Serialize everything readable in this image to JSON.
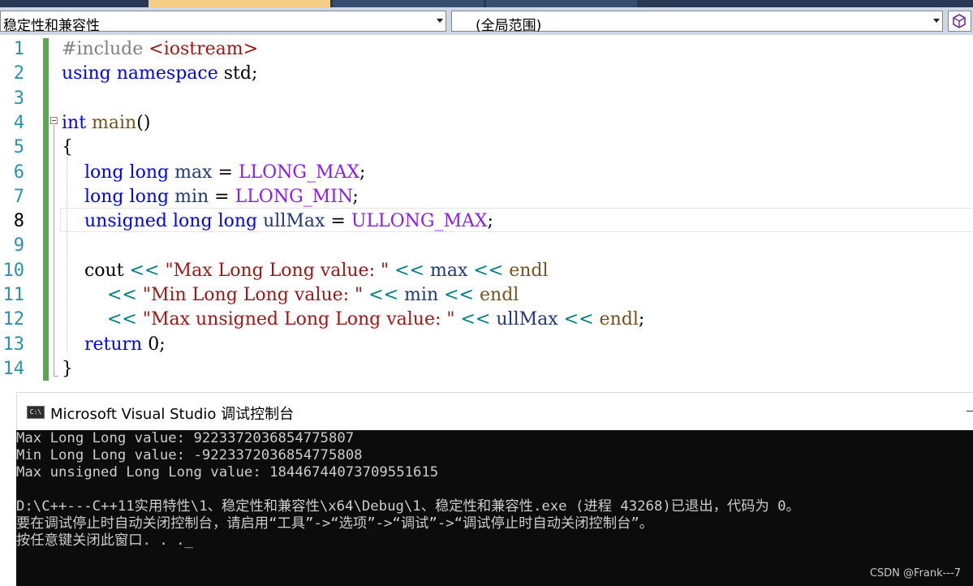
{
  "navbar": {
    "scope_left": "稳定性和兼容性",
    "scope_right": "(全局范围)"
  },
  "editor": {
    "current_line": 8,
    "lines": [
      {
        "n": "1",
        "tokens": [
          {
            "t": "#include ",
            "c": "pp"
          },
          {
            "t": "<iostream>",
            "c": "inc"
          }
        ]
      },
      {
        "n": "2",
        "tokens": [
          {
            "t": "using",
            "c": "kw"
          },
          {
            "t": " ",
            "c": "plain"
          },
          {
            "t": "namespace",
            "c": "kw"
          },
          {
            "t": " std;",
            "c": "plain"
          }
        ]
      },
      {
        "n": "3",
        "tokens": []
      },
      {
        "n": "4",
        "tokens": [
          {
            "t": "int",
            "c": "kw"
          },
          {
            "t": " ",
            "c": "plain"
          },
          {
            "t": "main",
            "c": "fn"
          },
          {
            "t": "()",
            "c": "plain"
          }
        ]
      },
      {
        "n": "5",
        "tokens": [
          {
            "t": "{",
            "c": "plain"
          }
        ]
      },
      {
        "n": "6",
        "tokens": [
          {
            "t": "    ",
            "c": "plain"
          },
          {
            "t": "long",
            "c": "kw"
          },
          {
            "t": " ",
            "c": "plain"
          },
          {
            "t": "long",
            "c": "kw"
          },
          {
            "t": " ",
            "c": "plain"
          },
          {
            "t": "max",
            "c": "id"
          },
          {
            "t": " = ",
            "c": "plain"
          },
          {
            "t": "LLONG_MAX",
            "c": "macro"
          },
          {
            "t": ";",
            "c": "plain"
          }
        ]
      },
      {
        "n": "7",
        "tokens": [
          {
            "t": "    ",
            "c": "plain"
          },
          {
            "t": "long",
            "c": "kw"
          },
          {
            "t": " ",
            "c": "plain"
          },
          {
            "t": "long",
            "c": "kw"
          },
          {
            "t": " ",
            "c": "plain"
          },
          {
            "t": "min",
            "c": "id"
          },
          {
            "t": " = ",
            "c": "plain"
          },
          {
            "t": "LLONG_MIN",
            "c": "macro"
          },
          {
            "t": ";",
            "c": "plain"
          }
        ]
      },
      {
        "n": "8",
        "tokens": [
          {
            "t": "    ",
            "c": "plain"
          },
          {
            "t": "unsigned",
            "c": "kw"
          },
          {
            "t": " ",
            "c": "plain"
          },
          {
            "t": "long",
            "c": "kw"
          },
          {
            "t": " ",
            "c": "plain"
          },
          {
            "t": "long",
            "c": "kw"
          },
          {
            "t": " ",
            "c": "plain"
          },
          {
            "t": "ullMax",
            "c": "id"
          },
          {
            "t": " = ",
            "c": "plain"
          },
          {
            "t": "ULLONG_MAX",
            "c": "macro"
          },
          {
            "t": ";",
            "c": "plain"
          }
        ]
      },
      {
        "n": "9",
        "tokens": []
      },
      {
        "n": "10",
        "tokens": [
          {
            "t": "    ",
            "c": "plain"
          },
          {
            "t": "cout",
            "c": "plain"
          },
          {
            "t": " ",
            "c": "plain"
          },
          {
            "t": "<<",
            "c": "op"
          },
          {
            "t": " ",
            "c": "plain"
          },
          {
            "t": "\"Max Long Long value: \"",
            "c": "str"
          },
          {
            "t": " ",
            "c": "plain"
          },
          {
            "t": "<<",
            "c": "op"
          },
          {
            "t": " ",
            "c": "plain"
          },
          {
            "t": "max",
            "c": "id"
          },
          {
            "t": " ",
            "c": "plain"
          },
          {
            "t": "<<",
            "c": "op"
          },
          {
            "t": " ",
            "c": "plain"
          },
          {
            "t": "endl",
            "c": "fn"
          }
        ]
      },
      {
        "n": "11",
        "tokens": [
          {
            "t": "        ",
            "c": "plain"
          },
          {
            "t": "<<",
            "c": "op"
          },
          {
            "t": " ",
            "c": "plain"
          },
          {
            "t": "\"Min Long Long value: \"",
            "c": "str"
          },
          {
            "t": " ",
            "c": "plain"
          },
          {
            "t": "<<",
            "c": "op"
          },
          {
            "t": " ",
            "c": "plain"
          },
          {
            "t": "min",
            "c": "id"
          },
          {
            "t": " ",
            "c": "plain"
          },
          {
            "t": "<<",
            "c": "op"
          },
          {
            "t": " ",
            "c": "plain"
          },
          {
            "t": "endl",
            "c": "fn"
          }
        ]
      },
      {
        "n": "12",
        "tokens": [
          {
            "t": "        ",
            "c": "plain"
          },
          {
            "t": "<<",
            "c": "op"
          },
          {
            "t": " ",
            "c": "plain"
          },
          {
            "t": "\"Max unsigned Long Long value: \"",
            "c": "str"
          },
          {
            "t": " ",
            "c": "plain"
          },
          {
            "t": "<<",
            "c": "op"
          },
          {
            "t": " ",
            "c": "plain"
          },
          {
            "t": "ullMax",
            "c": "id"
          },
          {
            "t": " ",
            "c": "plain"
          },
          {
            "t": "<<",
            "c": "op"
          },
          {
            "t": " ",
            "c": "plain"
          },
          {
            "t": "endl",
            "c": "fn"
          },
          {
            "t": ";",
            "c": "plain"
          }
        ]
      },
      {
        "n": "13",
        "tokens": [
          {
            "t": "    ",
            "c": "plain"
          },
          {
            "t": "return",
            "c": "kw"
          },
          {
            "t": " 0;",
            "c": "plain"
          }
        ]
      },
      {
        "n": "14",
        "tokens": [
          {
            "t": "}",
            "c": "plain"
          }
        ]
      }
    ]
  },
  "console": {
    "icon_text": "C:\\",
    "title": "Microsoft Visual Studio 调试控制台",
    "output": [
      "Max Long Long value: 9223372036854775807",
      "Min Long Long value: -9223372036854775808",
      "Max unsigned Long Long value: 18446744073709551615",
      "",
      "D:\\C++---C++11实用特性\\1、稳定性和兼容性\\x64\\Debug\\1、稳定性和兼容性.exe (进程 43268)已退出，代码为 0。",
      "要在调试停止时自动关闭控制台，请启用“工具”->“选项”->“调试”->“调试停止时自动关闭控制台”。",
      "按任意键关闭此窗口. . ._"
    ]
  },
  "watermark": "CSDN @Frank---7"
}
